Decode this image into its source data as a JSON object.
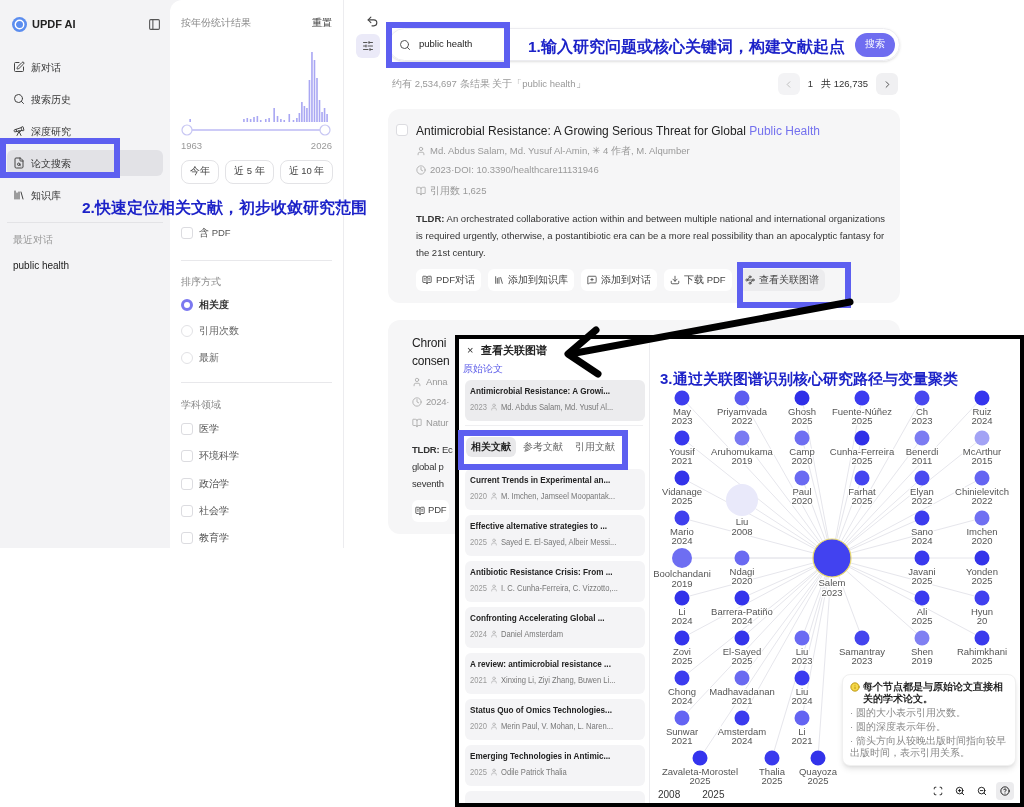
{
  "sidebar": {
    "logo": "UPDF AI",
    "items": [
      {
        "label": "新对话",
        "selected": false
      },
      {
        "label": "搜索历史",
        "selected": false
      },
      {
        "label": "深度研究",
        "selected": false
      },
      {
        "label": "论文搜索",
        "selected": true
      },
      {
        "label": "知识库",
        "selected": false
      }
    ],
    "recent_heading": "最近对话",
    "recent": [
      "public health"
    ]
  },
  "filters": {
    "year_title": "按年份统计结果",
    "reset": "重置",
    "year_slider": [
      {
        "level": 0
      },
      {
        "level": 1
      }
    ],
    "year_start": "1963",
    "year_end": "2026",
    "quick_years": [
      "今年",
      "近 5 年",
      "近 10 年"
    ],
    "pdf": {
      "label": "含 PDF",
      "checked": false
    },
    "sort_title": "排序方式",
    "sort": [
      {
        "label": "相关度",
        "selected": true
      },
      {
        "label": "引用次数",
        "selected": false
      },
      {
        "label": "最新",
        "selected": false
      }
    ],
    "field_title": "学科领域",
    "fields": [
      {
        "label": "医学",
        "checked": false
      },
      {
        "label": "环境科学",
        "checked": false
      },
      {
        "label": "政治学",
        "checked": false
      },
      {
        "label": "社会学",
        "checked": false
      },
      {
        "label": "教育学",
        "checked": false
      }
    ]
  },
  "search": {
    "value": "public health",
    "button": "搜索",
    "result_count": "约有 2,534,697 条结果 关于「public health」",
    "page": "1",
    "total_pages": "共 126,735"
  },
  "result": {
    "checked": false,
    "title": "Antimicrobial Resistance: A Growing Serious Threat for Global ",
    "title_highlight": "Public Health",
    "authors": "Md. Abdus Salam, Md. Yusuf Al-Amin, ✳ 4 作者, M. Alqumber",
    "meta": "2023·DOI: 10.3390/healthcare11131946",
    "line3": "引用数 1,625",
    "tldr": "**TLDR:** An orchestrated collaborative action within and between multiple national and international organizations is required urgently, otherwise, a postantibiotic era can be a more real possibility than an apocalyptic fantasy for the 21st century.",
    "actions": [
      "PDF对话",
      "添加到知识库",
      "添加到对话",
      "下载 PDF",
      "查看关联图谱"
    ]
  },
  "partial_result": {
    "title_lines": [
      "Chroni",
      "consen"
    ],
    "authors": "Anna",
    "meta": "2024·",
    "line3": "Natur",
    "tldr_lines": [
      "**TLDR:** Ec",
      "global p",
      "seventh"
    ],
    "action": "PDF"
  },
  "graph_panel": {
    "close": "×",
    "title": "查看关联图谱",
    "original_label": "原始论文",
    "original": {
      "title": "Antimicrobial Resistance: A Growi...",
      "year": "2023",
      "authors": "Md. Abdus Salam, Md. Yusuf Al..."
    },
    "tabs": [
      {
        "label": "相关文献",
        "selected": true
      },
      {
        "label": "参考文献",
        "selected": false
      },
      {
        "label": "引用文献",
        "selected": false
      }
    ],
    "papers": [
      {
        "title": "Current Trends in Experimental an...",
        "year": "2020",
        "authors": "M. Imchen, Jamseel Moopantak..."
      },
      {
        "title": "Effective alternative strategies to ...",
        "year": "2025",
        "authors": "Sayed E. El-Sayed, Albeir Messi..."
      },
      {
        "title": "Antibiotic Resistance Crisis: From ...",
        "year": "2025",
        "authors": "I. C. Cunha-Ferreira, C. Vizzotto,..."
      },
      {
        "title": "Confronting Accelerating Global ...",
        "year": "2024",
        "authors": "Daniel Amsterdam"
      },
      {
        "title": "A review: antimicrobial resistance ...",
        "year": "2021",
        "authors": "Xinxing Li, Ziyi Zhang, Buwen Li..."
      },
      {
        "title": "Status Quo of Omics Technologies...",
        "year": "2020",
        "authors": "Merin Paul, V. Mohan, L. Naren..."
      },
      {
        "title": "Emerging Technologies in Antimic...",
        "year": "2025",
        "authors": "Odile Patrick Thalia"
      }
    ],
    "nodes": [
      {
        "label": "May 2023",
        "color": "#3d3dee",
        "kind": "small"
      },
      {
        "label": "Priyamvada 2022",
        "color": "#5c5cf0",
        "kind": "small"
      },
      {
        "label": "Ghosh 2025",
        "color": "#2f2fe8",
        "kind": "small"
      },
      {
        "label": "Fuente-Núñez 2025",
        "color": "#3b3bf0",
        "kind": "small"
      },
      {
        "label": "Ch 2023",
        "color": "#4848f0",
        "kind": "small"
      },
      {
        "label": "Ruiz 2024",
        "color": "#3535ee",
        "kind": "small"
      },
      {
        "label": "Yousif 2021",
        "color": "#3838ee",
        "kind": "small"
      },
      {
        "label": "Aruhomukama 2019",
        "color": "#7a7af2",
        "kind": "small"
      },
      {
        "label": "Camp 2020",
        "color": "#6f6ff2",
        "kind": "small"
      },
      {
        "label": "Cunha-Ferreira 2025",
        "color": "#3030e8",
        "kind": "small"
      },
      {
        "label": "Benerdi 2011",
        "color": "#7c7cf2",
        "kind": "small"
      },
      {
        "label": "McArthur 2015",
        "color": "#a3a3f5",
        "kind": "small"
      },
      {
        "label": "Vidanage 2025",
        "color": "#3333ea",
        "kind": "small"
      },
      {
        "label": "Paul 2020",
        "color": "#6a6af2",
        "kind": "small"
      },
      {
        "label": "Farhat 2025",
        "color": "#4545f0",
        "kind": "small"
      },
      {
        "label": "Elyan 2022",
        "color": "#4a4af0",
        "kind": "small"
      },
      {
        "label": "Chinielevitch 2022",
        "color": "#6565f2",
        "kind": "small"
      },
      {
        "label": "Liu 2008",
        "color": "#e9e9fa",
        "kind": "large"
      },
      {
        "label": "Mario 2024",
        "color": "#4040ee",
        "kind": "small"
      },
      {
        "label": "Sano 2024",
        "color": "#3c3cee",
        "kind": "small"
      },
      {
        "label": "Imchen 2020",
        "color": "#7070f2",
        "kind": "small"
      },
      {
        "label": "Boolchandani 2019",
        "color": "#6e6ef2",
        "kind": "medium"
      },
      {
        "label": "Ndagi 2020",
        "color": "#6a6af2",
        "kind": "small"
      },
      {
        "label": "Salem 2023",
        "color": "#4242f0",
        "kind": "center"
      },
      {
        "label": "Javani 2025",
        "color": "#3a3aee",
        "kind": "small"
      },
      {
        "label": "Yonden 2025",
        "color": "#3434ea",
        "kind": "small"
      },
      {
        "label": "Li 2024",
        "color": "#3232ea",
        "kind": "small"
      },
      {
        "label": "Barrera-Patiño 2024",
        "color": "#3434ec",
        "kind": "small"
      },
      {
        "label": "Ali 2025",
        "color": "#3a3aef",
        "kind": "small"
      },
      {
        "label": "Hyun 20",
        "color": "#4040ef",
        "kind": "small"
      },
      {
        "label": "Zovi 2025",
        "color": "#3434ed",
        "kind": "small"
      },
      {
        "label": "El-Sayed 2025",
        "color": "#3434eb",
        "kind": "small"
      },
      {
        "label": "Liu 2023",
        "color": "#6a6af3",
        "kind": "small"
      },
      {
        "label": "Samantray 2023",
        "color": "#4444ee",
        "kind": "small"
      },
      {
        "label": "Shen 2019",
        "color": "#8080f2",
        "kind": "small"
      },
      {
        "label": "Rahimkhani 2025",
        "color": "#3a3aed",
        "kind": "small"
      },
      {
        "label": "Chong 2024",
        "color": "#3c3cef",
        "kind": "small"
      },
      {
        "label": "Madhavadanan 2021",
        "color": "#6a6af1",
        "kind": "small"
      },
      {
        "label": "Liu 2024",
        "color": "#3a3af0",
        "kind": "small"
      },
      {
        "label": "Sunwar 2021",
        "color": "#6464f3",
        "kind": "small"
      },
      {
        "label": "Amsterdam 2024",
        "color": "#3b3bee",
        "kind": "small"
      },
      {
        "label": "Li 2021",
        "color": "#6464f2",
        "kind": "small"
      },
      {
        "label": "Zavaleta-Morostel 2025",
        "color": "#3434ee",
        "kind": "small"
      },
      {
        "label": "Thalia 2025",
        "color": "#3a3aee",
        "kind": "small"
      },
      {
        "label": "Quayoza 2025",
        "color": "#3232ea",
        "kind": "small"
      }
    ],
    "legend": [
      "2008",
      "2025"
    ],
    "info": {
      "title": "每个节点都是与原始论文直接相关的学术论文。",
      "points": [
        "· 圆的大小表示引用次数。",
        "· 圆的深度表示年份。",
        "· 箭头方向从较晚出版时间指向较早出版时间，表示引用关系。"
      ]
    }
  },
  "annotations": [
    "1.输入研究问题或核心关键词，构建文献起点",
    "2.快速定位相关文献，初步收敛研究范围",
    "3.通过关联图谱识别核心研究路径与变量聚类"
  ]
}
